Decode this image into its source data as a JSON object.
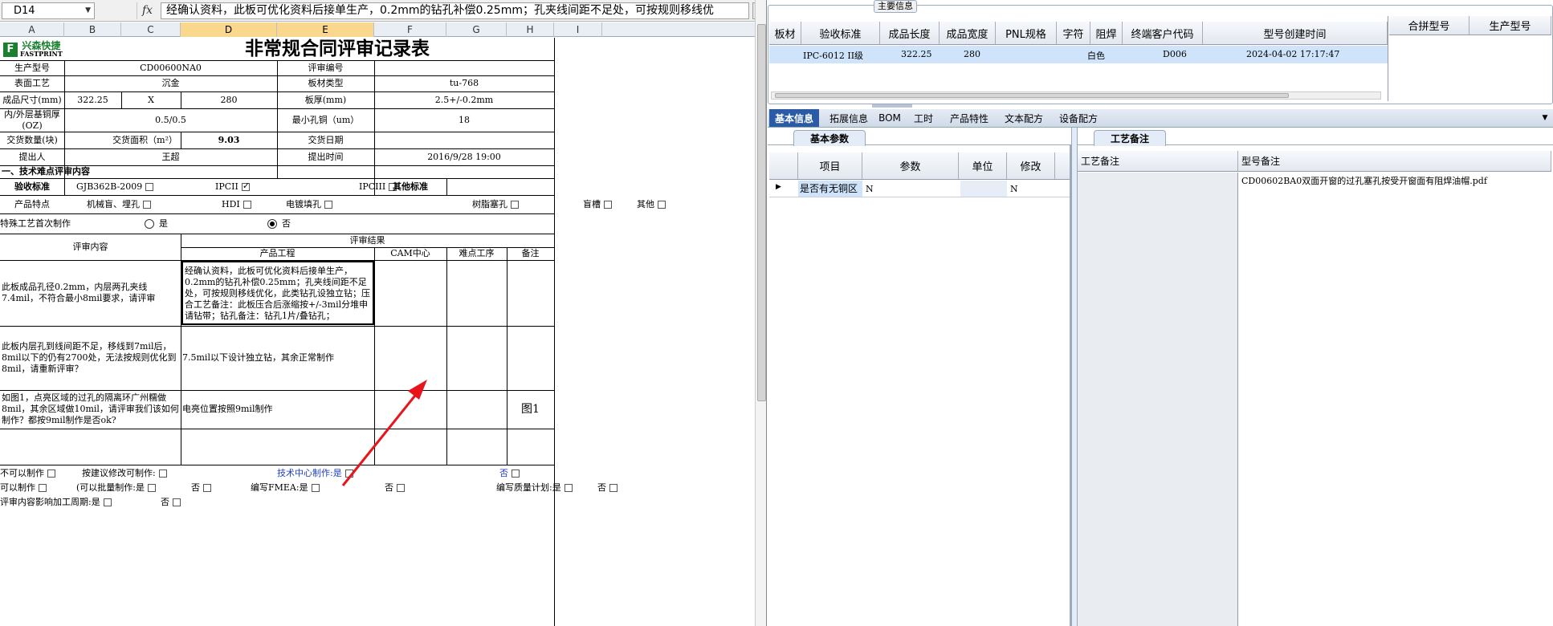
{
  "formula_bar": {
    "name_box": "D14",
    "fx_label": "fx",
    "formula": "经确认资料，此板可优化资料后接单生产，0.2mm的钻孔补偿0.25mm；孔夹线间距不足处，可按规则移线优"
  },
  "columns": [
    "A",
    "B",
    "C",
    "D",
    "E",
    "F",
    "G",
    "H",
    "I"
  ],
  "sheet": {
    "logo_cn": "兴森快捷",
    "logo_en": "FASTPRINT",
    "title": "非常规合同评审记录表",
    "labels": {
      "product_model": "生产型号",
      "review_no": "评审编号",
      "surface": "表面工艺",
      "board_type": "板材类型",
      "size": "成品尺寸(mm)",
      "thickness": "板厚(mm)",
      "copper": "内/外层基铜厚(OZ)",
      "min_hole": "最小孔铜（um）",
      "qty": "交货数量(块)",
      "area": "交货面积（m²）",
      "delivery_date": "交货日期",
      "proposer": "提出人",
      "propose_time": "提出时间",
      "section1": "一、技术难点评审内容",
      "accept_std": "验收标准",
      "other_std": "其他标准",
      "features": "产品特点",
      "first_make": "特殊工艺首次制作",
      "review_content": "评审内容",
      "review_result": "评审结果",
      "prod_eng": "产品工程",
      "cam": "CAM中心",
      "difficult": "难点工序",
      "remark": "备注"
    },
    "values": {
      "product_model": "CD00600NA0",
      "review_no": "",
      "surface": "沉金",
      "board_type": "tu-768",
      "size_x": "322.25",
      "size_sep": "X",
      "size_y": "280",
      "thickness": "2.5+/-0.2mm",
      "copper": "0.5/0.5",
      "min_hole": "18",
      "area": "9.03",
      "proposer": "王超",
      "propose_time": "2016/9/28 19:00"
    },
    "accept_options": [
      "GJB362B-2009",
      "IPCII",
      "IPCIII"
    ],
    "feature_options": [
      "机械盲、埋孔",
      "HDI",
      "电镀填孔",
      "树脂塞孔",
      "盲槽",
      "其他"
    ],
    "first_make_options": [
      "是",
      "否"
    ],
    "rows": [
      {
        "content": "此板成品孔径0.2mm，内层两孔夹线7.4mil，不符合最小8mil要求，请评审",
        "prod": "经确认资料，此板可优化资料后接单生产，0.2mm的钻孔补偿0.25mm；孔夹线间距不足处，可按规则移线优化，此类钻孔设独立钻；压合工艺备注：此板压合后涨缩按+/-3mil分堆申请钻带；钻孔备注：钻孔1片/叠钻孔；",
        "remark": ""
      },
      {
        "content": "此板内层孔到线间距不足，移线到7mil后，8mil以下的仍有2700处，无法按规则优化到8mil，请重新评审？",
        "prod": "7.5mil以下设计独立钻，其余正常制作",
        "remark": ""
      },
      {
        "content": "如图1，点亮区域的过孔的隔离环广州糯做8mil，其余区域做10mil，请评审我们该如何制作？都按9mil制作是否ok?",
        "prod": "电亮位置按照9mil制作",
        "remark": "图1"
      }
    ],
    "footer": {
      "cannot": "不可以制作",
      "suggest": "按建议修改可制作:",
      "tech_center": "技术中心制作:是",
      "no": "否",
      "can": "可以制作",
      "batch": "(可以批量制作:是",
      "batch_no": "否",
      "fmea": "编写FMEA:是",
      "fmea_no": "否",
      "quality": "编写质量计划:是",
      "quality_no": "否",
      "cycle": "评审内容影响加工周期:是",
      "cycle_no": "否"
    }
  },
  "right_panel": {
    "main_info_title": "主要信息",
    "main_headers": [
      "板材",
      "验收标准",
      "成品长度",
      "成品宽度",
      "PNL规格",
      "字符",
      "阻焊",
      "终端客户代码",
      "型号创建时间"
    ],
    "main_row": [
      "",
      "IPC-6012 II级",
      "322.25",
      "280",
      "",
      "白色",
      "",
      "D006",
      "2024-04-02 17:17:47"
    ],
    "side_headers": [
      "合拼型号",
      "生产型号"
    ],
    "tabs": [
      "基本信息",
      "拓展信息",
      "BOM",
      "工时",
      "产品特性",
      "文本配方",
      "设备配方"
    ],
    "basic_params_tab": "基本参数",
    "param_headers": [
      "项目",
      "参数",
      "单位",
      "修改"
    ],
    "param_row": [
      "是否有无铜区",
      "N",
      "",
      "N"
    ],
    "craft_tab": "工艺备注",
    "craft_headers": [
      "工艺备注",
      "型号备注"
    ],
    "craft_row": [
      "",
      "CD00602BA0双面开窗的过孔塞孔按受开窗面有阻焊油帽.pdf"
    ]
  },
  "colors": {
    "accent": "#2b5ba7",
    "selection": "#cfe3fb",
    "arrow": "#e8141c",
    "header_sel": "#f9d78c"
  }
}
